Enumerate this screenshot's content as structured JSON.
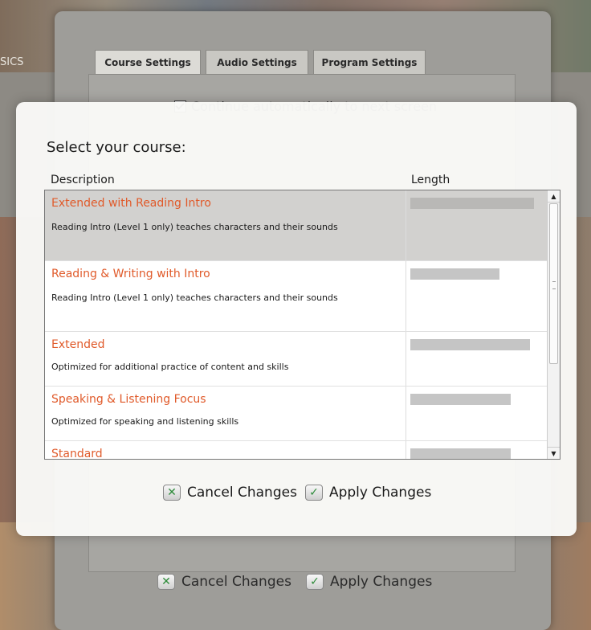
{
  "background": {
    "side_label": "SICS",
    "tabs": [
      {
        "label": "Course Settings",
        "active": true
      },
      {
        "label": "Audio Settings",
        "active": false
      },
      {
        "label": "Program Settings",
        "active": false
      }
    ],
    "continue_checkbox": {
      "label": "Continue automatically to next screen",
      "checked": true
    },
    "buttons": {
      "cancel": "Cancel Changes",
      "apply": "Apply Changes"
    }
  },
  "dialog": {
    "title": "Select your course:",
    "columns": {
      "description": "Description",
      "length": "Length"
    },
    "courses": [
      {
        "name": "Extended with Reading Intro",
        "description": "Reading Intro (Level 1 only) teaches characters and their sounds",
        "length_fraction": 1.0,
        "selected": true
      },
      {
        "name": "Reading & Writing with Intro",
        "description": "Reading Intro (Level 1 only) teaches characters and their sounds",
        "length_fraction": 0.72,
        "selected": false
      },
      {
        "name": "Extended",
        "description": "Optimized for additional practice of content and skills",
        "length_fraction": 0.97,
        "selected": false
      },
      {
        "name": "Speaking & Listening Focus",
        "description": "Optimized for speaking and listening skills",
        "length_fraction": 0.81,
        "selected": false
      },
      {
        "name": "Standard",
        "description": "",
        "length_fraction": 0.81,
        "selected": false
      }
    ],
    "buttons": {
      "cancel": "Cancel Changes",
      "apply": "Apply Changes"
    }
  },
  "icons": {
    "cancel": "x-icon",
    "apply": "check-icon",
    "scroll_up": "arrow-up-icon",
    "scroll_down": "arrow-down-icon"
  },
  "colors": {
    "course_name": "#e05a2a",
    "selected_row": "#d2d1cf",
    "length_bar": "#c5c5c5"
  }
}
